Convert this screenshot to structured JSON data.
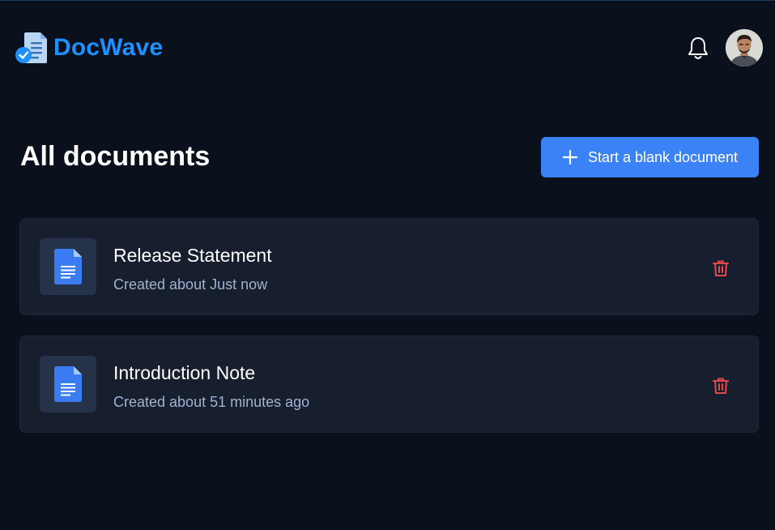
{
  "app": {
    "name": "DocWave",
    "brand_color": "#1e90ff"
  },
  "header": {
    "notification_icon": "bell-icon",
    "avatar_icon": "user-avatar"
  },
  "main": {
    "title": "All documents",
    "new_document_label": "Start a blank document",
    "accent_color": "#3b82f6"
  },
  "documents": [
    {
      "title": "Release Statement",
      "meta": "Created about Just now",
      "icon": "document-icon",
      "delete_icon": "trash-icon"
    },
    {
      "title": "Introduction Note",
      "meta": "Created about 51 minutes ago",
      "icon": "document-icon",
      "delete_icon": "trash-icon"
    }
  ]
}
